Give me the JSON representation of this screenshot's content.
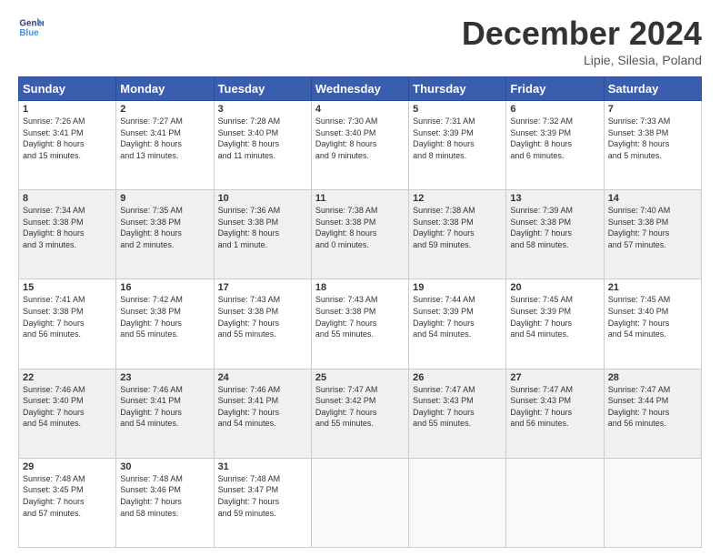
{
  "logo": {
    "general": "General",
    "blue": "Blue"
  },
  "title": "December 2024",
  "subtitle": "Lipie, Silesia, Poland",
  "days_header": [
    "Sunday",
    "Monday",
    "Tuesday",
    "Wednesday",
    "Thursday",
    "Friday",
    "Saturday"
  ],
  "weeks": [
    [
      {
        "day": "1",
        "info": "Sunrise: 7:26 AM\nSunset: 3:41 PM\nDaylight: 8 hours\nand 15 minutes."
      },
      {
        "day": "2",
        "info": "Sunrise: 7:27 AM\nSunset: 3:41 PM\nDaylight: 8 hours\nand 13 minutes."
      },
      {
        "day": "3",
        "info": "Sunrise: 7:28 AM\nSunset: 3:40 PM\nDaylight: 8 hours\nand 11 minutes."
      },
      {
        "day": "4",
        "info": "Sunrise: 7:30 AM\nSunset: 3:40 PM\nDaylight: 8 hours\nand 9 minutes."
      },
      {
        "day": "5",
        "info": "Sunrise: 7:31 AM\nSunset: 3:39 PM\nDaylight: 8 hours\nand 8 minutes."
      },
      {
        "day": "6",
        "info": "Sunrise: 7:32 AM\nSunset: 3:39 PM\nDaylight: 8 hours\nand 6 minutes."
      },
      {
        "day": "7",
        "info": "Sunrise: 7:33 AM\nSunset: 3:38 PM\nDaylight: 8 hours\nand 5 minutes."
      }
    ],
    [
      {
        "day": "8",
        "info": "Sunrise: 7:34 AM\nSunset: 3:38 PM\nDaylight: 8 hours\nand 3 minutes."
      },
      {
        "day": "9",
        "info": "Sunrise: 7:35 AM\nSunset: 3:38 PM\nDaylight: 8 hours\nand 2 minutes."
      },
      {
        "day": "10",
        "info": "Sunrise: 7:36 AM\nSunset: 3:38 PM\nDaylight: 8 hours\nand 1 minute."
      },
      {
        "day": "11",
        "info": "Sunrise: 7:38 AM\nSunset: 3:38 PM\nDaylight: 8 hours\nand 0 minutes."
      },
      {
        "day": "12",
        "info": "Sunrise: 7:38 AM\nSunset: 3:38 PM\nDaylight: 7 hours\nand 59 minutes."
      },
      {
        "day": "13",
        "info": "Sunrise: 7:39 AM\nSunset: 3:38 PM\nDaylight: 7 hours\nand 58 minutes."
      },
      {
        "day": "14",
        "info": "Sunrise: 7:40 AM\nSunset: 3:38 PM\nDaylight: 7 hours\nand 57 minutes."
      }
    ],
    [
      {
        "day": "15",
        "info": "Sunrise: 7:41 AM\nSunset: 3:38 PM\nDaylight: 7 hours\nand 56 minutes."
      },
      {
        "day": "16",
        "info": "Sunrise: 7:42 AM\nSunset: 3:38 PM\nDaylight: 7 hours\nand 55 minutes."
      },
      {
        "day": "17",
        "info": "Sunrise: 7:43 AM\nSunset: 3:38 PM\nDaylight: 7 hours\nand 55 minutes."
      },
      {
        "day": "18",
        "info": "Sunrise: 7:43 AM\nSunset: 3:38 PM\nDaylight: 7 hours\nand 55 minutes."
      },
      {
        "day": "19",
        "info": "Sunrise: 7:44 AM\nSunset: 3:39 PM\nDaylight: 7 hours\nand 54 minutes."
      },
      {
        "day": "20",
        "info": "Sunrise: 7:45 AM\nSunset: 3:39 PM\nDaylight: 7 hours\nand 54 minutes."
      },
      {
        "day": "21",
        "info": "Sunrise: 7:45 AM\nSunset: 3:40 PM\nDaylight: 7 hours\nand 54 minutes."
      }
    ],
    [
      {
        "day": "22",
        "info": "Sunrise: 7:46 AM\nSunset: 3:40 PM\nDaylight: 7 hours\nand 54 minutes."
      },
      {
        "day": "23",
        "info": "Sunrise: 7:46 AM\nSunset: 3:41 PM\nDaylight: 7 hours\nand 54 minutes."
      },
      {
        "day": "24",
        "info": "Sunrise: 7:46 AM\nSunset: 3:41 PM\nDaylight: 7 hours\nand 54 minutes."
      },
      {
        "day": "25",
        "info": "Sunrise: 7:47 AM\nSunset: 3:42 PM\nDaylight: 7 hours\nand 55 minutes."
      },
      {
        "day": "26",
        "info": "Sunrise: 7:47 AM\nSunset: 3:43 PM\nDaylight: 7 hours\nand 55 minutes."
      },
      {
        "day": "27",
        "info": "Sunrise: 7:47 AM\nSunset: 3:43 PM\nDaylight: 7 hours\nand 56 minutes."
      },
      {
        "day": "28",
        "info": "Sunrise: 7:47 AM\nSunset: 3:44 PM\nDaylight: 7 hours\nand 56 minutes."
      }
    ],
    [
      {
        "day": "29",
        "info": "Sunrise: 7:48 AM\nSunset: 3:45 PM\nDaylight: 7 hours\nand 57 minutes."
      },
      {
        "day": "30",
        "info": "Sunrise: 7:48 AM\nSunset: 3:46 PM\nDaylight: 7 hours\nand 58 minutes."
      },
      {
        "day": "31",
        "info": "Sunrise: 7:48 AM\nSunset: 3:47 PM\nDaylight: 7 hours\nand 59 minutes."
      },
      {
        "day": "",
        "info": ""
      },
      {
        "day": "",
        "info": ""
      },
      {
        "day": "",
        "info": ""
      },
      {
        "day": "",
        "info": ""
      }
    ]
  ]
}
